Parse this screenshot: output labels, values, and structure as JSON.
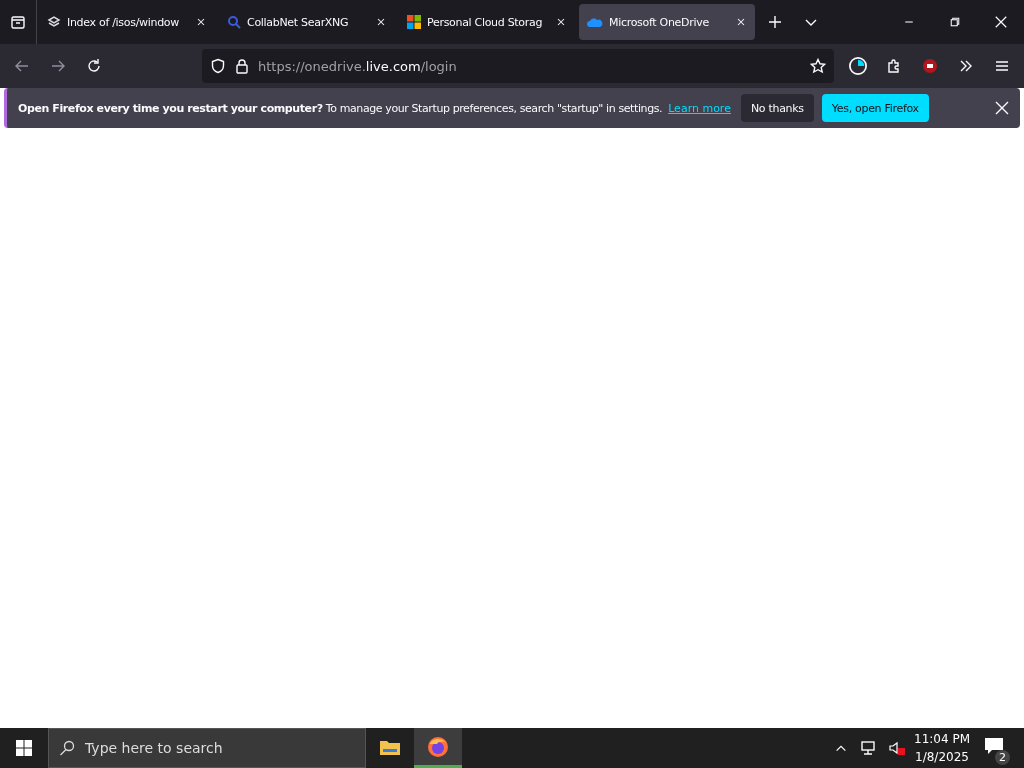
{
  "tabs": [
    {
      "kind": "stack",
      "title": "Index of /isos/window",
      "selected": false
    },
    {
      "kind": "search",
      "title": "CollabNet SearXNG",
      "selected": false
    },
    {
      "kind": "windows",
      "title": "Personal Cloud Storag",
      "selected": false
    },
    {
      "kind": "cloud",
      "title": "Microsoft OneDrive",
      "selected": true
    }
  ],
  "url": {
    "prefix": "https://onedrive.",
    "host": "live.com",
    "path": "/login"
  },
  "notification": {
    "message": "**Open Firefox every time you restart your computer?** To manage your Startup preferences, search \"startup\" in settings.",
    "link": "Learn more",
    "buttons": [
      {
        "label": "No thanks",
        "kind": "secondary"
      },
      {
        "label": "Yes, open Firefox",
        "kind": "primary"
      }
    ]
  },
  "taskbar": {
    "search_placeholder": "Type here to search",
    "apps": [
      {
        "kind": "folder",
        "active": false
      },
      {
        "kind": "firefox",
        "active": true
      }
    ],
    "time": "11:04 PM",
    "date": "1/8/2025",
    "notifications": "2"
  }
}
